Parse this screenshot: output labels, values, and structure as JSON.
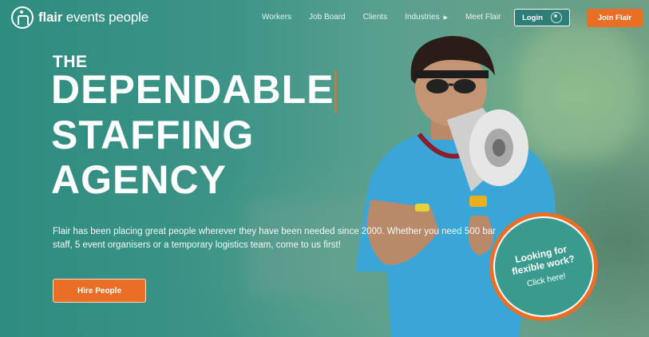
{
  "brand": {
    "name_bold": "flair",
    "name_rest": "events people"
  },
  "nav": {
    "items": [
      "Workers",
      "Job Board",
      "Clients",
      "Industries",
      "Meet Flair"
    ],
    "industries_caret": "▶"
  },
  "auth": {
    "login_label": "Login",
    "join_label": "Join Flair"
  },
  "hero": {
    "kicker": "THE",
    "lines": [
      "DEPENDABLE",
      "STAFFING",
      "AGENCY"
    ],
    "description": "Flair has been placing great people wherever they have been needed since 2000. Whether you need 500 bar staff, 5 event organisers or a temporary logistics team, come to us first!",
    "cta_label": "Hire People"
  },
  "badge": {
    "title": "Looking for flexible work?",
    "subtitle": "Click here!"
  },
  "colors": {
    "accent": "#e96f27",
    "teal": "#3a9a8e",
    "dark_teal": "#2e7e78"
  }
}
